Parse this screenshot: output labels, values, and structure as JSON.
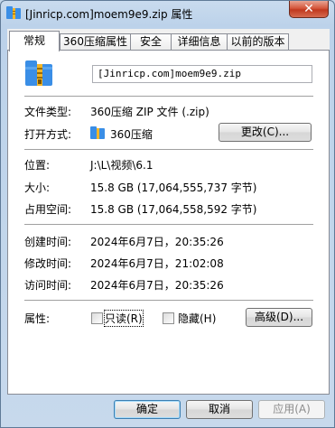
{
  "window": {
    "title": "[Jinricp.com]moem9e9.zip 属性",
    "close_symbol": "✕"
  },
  "tabs": [
    {
      "label": "常规"
    },
    {
      "label": "360压缩属性"
    },
    {
      "label": "安全"
    },
    {
      "label": "详细信息"
    },
    {
      "label": "以前的版本"
    }
  ],
  "general": {
    "filename": "[Jinricp.com]moem9e9.zip",
    "type_label": "文件类型:",
    "type_value": "360压缩 ZIP 文件 (.zip)",
    "opens_with_label": "打开方式:",
    "opens_with_value": "360压缩",
    "change_button": "更改(C)...",
    "location_label": "位置:",
    "location_value": "J:\\L\\视频\\6.1",
    "size_label": "大小:",
    "size_value": "15.8 GB (17,064,555,737 字节)",
    "size_on_disk_label": "占用空间:",
    "size_on_disk_value": "15.8 GB (17,064,558,592 字节)",
    "created_label": "创建时间:",
    "created_value": "2024年6月7日，20:35:26",
    "modified_label": "修改时间:",
    "modified_value": "2024年6月7日，21:02:08",
    "accessed_label": "访问时间:",
    "accessed_value": "2024年6月7日，20:35:26",
    "attributes_label": "属性:",
    "readonly_label": "只读(R)",
    "hidden_label": "隐藏(H)",
    "advanced_button": "高级(D)..."
  },
  "footer": {
    "ok": "确定",
    "cancel": "取消",
    "apply": "应用(A)"
  },
  "colors": {
    "zip_icon_blue": "#3a8ee6",
    "zip_icon_yellow": "#f3b528",
    "close_red": "#c0391f"
  },
  "icons": [
    "zip-archive-icon",
    "360zip-app-icon",
    "close-icon"
  ]
}
